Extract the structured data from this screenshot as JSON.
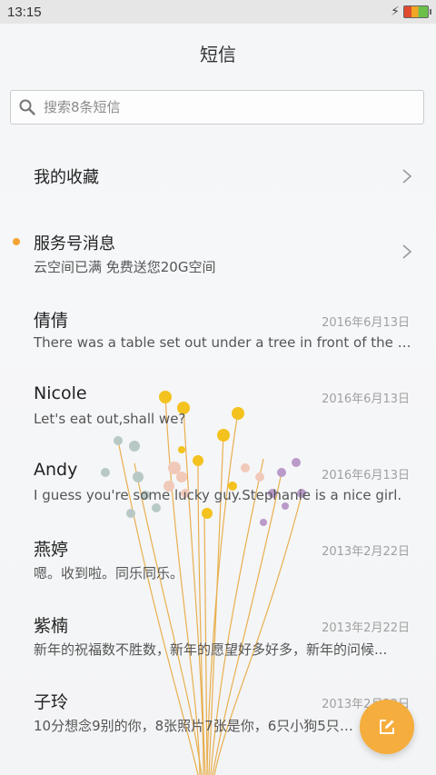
{
  "status_bar": {
    "time": "13:15"
  },
  "header": {
    "title": "短信"
  },
  "search": {
    "placeholder": "搜索8条短信"
  },
  "favorites": {
    "label": "我的收藏"
  },
  "service": {
    "title": "服务号消息",
    "subtitle": "云空间已满 免费送您20G空间",
    "unread": true
  },
  "conversations": [
    {
      "name": "倩倩",
      "date": "2016年6月13日",
      "snippet": "There was a table set out under a tree in front of the ho..."
    },
    {
      "name": "Nicole",
      "date": "2016年6月13日",
      "snippet": "Let's eat out,shall we?"
    },
    {
      "name": "Andy",
      "date": "2016年6月13日",
      "snippet": "I guess you're some lucky guy.Stephanie is a nice girl."
    },
    {
      "name": "燕婷",
      "date": "2013年2月22日",
      "snippet": "嗯。收到啦。同乐同乐。"
    },
    {
      "name": "紫楠",
      "date": "2013年2月22日",
      "snippet": "新年的祝福数不胜数，新年的愿望好多好多，新年的问候..."
    },
    {
      "name": "子玲",
      "date": "2013年2月22日",
      "snippet": "10分想念9别的你，8张照片7张是你，6只小狗5只像你..."
    }
  ],
  "icons": {
    "search": "search-icon",
    "chevron": "chevron-right-icon",
    "compose": "compose-icon",
    "bolt": "charging-bolt-icon",
    "battery": "battery-icon"
  },
  "colors": {
    "accent": "#f5ad3d",
    "unread_dot": "#f2a332"
  }
}
